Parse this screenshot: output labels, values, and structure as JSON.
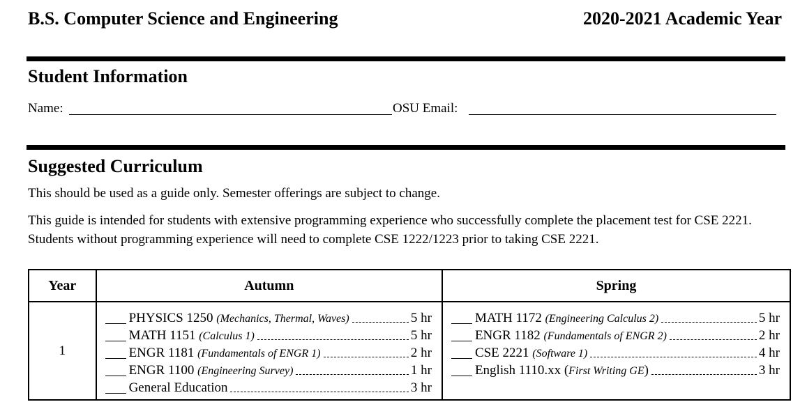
{
  "header": {
    "program": "B.S. Computer Science and Engineering",
    "year": "2020-2021 Academic Year"
  },
  "student_info": {
    "title": "Student Information",
    "name_label": "Name:",
    "email_label": "OSU Email:"
  },
  "curriculum": {
    "title": "Suggested Curriculum",
    "note1": "This should be used as a guide only. Semester offerings are subject to change.",
    "note2": "This guide is intended for students with extensive programming experience who successfully complete the placement test for CSE 2221. Students without programming experience will need to complete CSE 1222/1223 prior to taking CSE 2221."
  },
  "table": {
    "headers": {
      "year": "Year",
      "autumn": "Autumn",
      "spring": "Spring"
    },
    "rows": [
      {
        "year": "1",
        "autumn": [
          {
            "course": "PHYSICS 1250",
            "open": "",
            "desc": "(Mechanics, Thermal, Waves)",
            "close": "",
            "hours": "5 hr"
          },
          {
            "course": "MATH 1151",
            "open": "",
            "desc": "(Calculus 1)",
            "close": "",
            "hours": "5 hr"
          },
          {
            "course": "ENGR 1181",
            "open": "",
            "desc": "(Fundamentals of ENGR 1)",
            "close": "",
            "hours": "2 hr"
          },
          {
            "course": "ENGR 1100",
            "open": "",
            "desc": "(Engineering Survey)",
            "close": "",
            "hours": "1 hr"
          },
          {
            "course": "General Education",
            "open": "",
            "desc": "",
            "close": "",
            "hours": "3 hr"
          }
        ],
        "spring": [
          {
            "course": "MATH 1172",
            "open": "",
            "desc": "(Engineering Calculus 2)",
            "close": "",
            "hours": "5 hr"
          },
          {
            "course": "ENGR 1182",
            "open": "",
            "desc": "(Fundamentals of ENGR 2)",
            "close": "",
            "hours": "2 hr"
          },
          {
            "course": "CSE 2221",
            "open": "",
            "desc": "(Software 1)",
            "close": "",
            "hours": "4 hr"
          },
          {
            "course": "English 1110.xx",
            "open": "(",
            "desc": "First Writing GE",
            "close": ")",
            "hours": "3 hr"
          }
        ]
      }
    ]
  }
}
